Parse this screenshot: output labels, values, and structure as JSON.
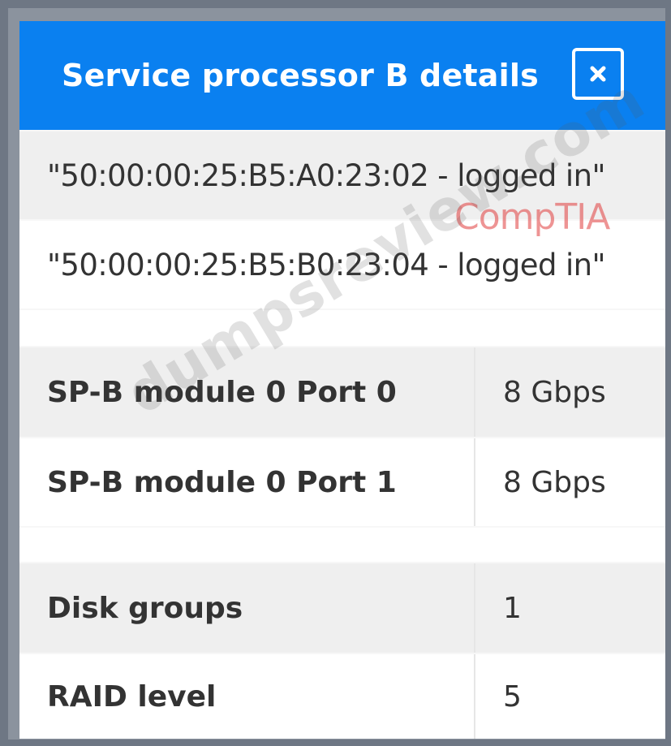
{
  "dialog": {
    "title": "Service processor B details",
    "close_icon": "close-icon",
    "accent_color": "#0a80f0"
  },
  "logins": [
    "\"50:00:00:25:B5:A0:23:02 - logged in\"",
    "\"50:00:00:25:B5:B0:23:04 - logged in\""
  ],
  "ports": [
    {
      "label": "SP-B module 0 Port 0",
      "value": "8 Gbps"
    },
    {
      "label": "SP-B module 0 Port 1",
      "value": "8 Gbps"
    }
  ],
  "storage": [
    {
      "label": "Disk groups",
      "value": "1"
    },
    {
      "label": "RAID level",
      "value": "5"
    }
  ],
  "watermark": {
    "brand": "CompTIA",
    "site": "dumpsreview.com"
  }
}
